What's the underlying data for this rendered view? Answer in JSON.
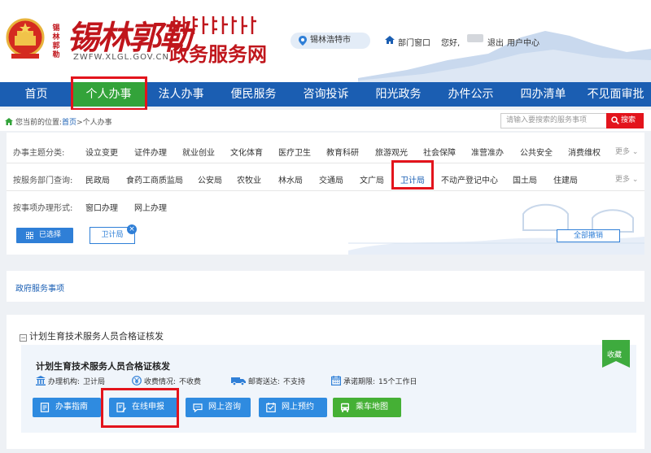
{
  "header": {
    "logo_calligraphy": "锡林郭勒",
    "logo_url": "ZWFW.XLGL.GOV.CN",
    "logo_title": "政务服务网",
    "seal_text": "锡林郭勒",
    "region": "锡林浩特市",
    "dept_window": "部门窗口",
    "greeting": "您好,",
    "logout": "退出",
    "user_center": "用户中心"
  },
  "nav": {
    "items": [
      "首页",
      "个人办事",
      "法人办事",
      "便民服务",
      "咨询投诉",
      "阳光政务",
      "办件公示",
      "四办清单",
      "不见面审批"
    ],
    "active_index": 1
  },
  "breadcrumb": {
    "prefix": "您当前的位置:",
    "home": "首页",
    "separator": ">",
    "current": "个人办事"
  },
  "search": {
    "placeholder": "请输入要搜索的服务事项",
    "button": "搜索"
  },
  "filters": {
    "theme": {
      "label": "办事主题分类:",
      "options": [
        "设立变更",
        "证件办理",
        "就业创业",
        "文化体育",
        "医疗卫生",
        "教育科研",
        "旅游观光",
        "社会保障",
        "准营准办",
        "公共安全",
        "消费维权"
      ],
      "more": "更多"
    },
    "dept": {
      "label": "按服务部门查询:",
      "options": [
        "民政局",
        "食药工商质监局",
        "公安局",
        "农牧业",
        "林水局",
        "交通局",
        "文广局",
        "卫计局",
        "不动产登记中心",
        "国土局",
        "住建局"
      ],
      "selected": "卫计局",
      "more": "更多"
    },
    "method": {
      "label": "按事项办理形式:",
      "options": [
        "窗口办理",
        "网上办理"
      ]
    },
    "selected_label": "已选择",
    "selected_tag": "卫计局",
    "clear_all": "全部撤销"
  },
  "section": {
    "title": "政府服务事项"
  },
  "item": {
    "title": "计划生育技术服务人员合格证核发",
    "collapse_symbol": "−",
    "name": "计划生育技术服务人员合格证核发",
    "favorite": "收藏",
    "org_label": "办理机构:",
    "org_value": "卫计局",
    "fee_label": "收费情况:",
    "fee_value": "不收费",
    "mail_label": "邮寄送达:",
    "mail_value": "不支持",
    "deadline_label": "承诺期限:",
    "deadline_value": "15个工作日",
    "actions": {
      "guide": "办事指南",
      "apply": "在线申报",
      "consult": "网上咨询",
      "reserve": "网上预约",
      "map": "乘车地图"
    }
  },
  "colors": {
    "nav_blue": "#1b5eb2",
    "active_green": "#33a33a",
    "brand_red": "#c0161c",
    "highlight_red": "#e3141c",
    "button_blue": "#2f8be0"
  }
}
